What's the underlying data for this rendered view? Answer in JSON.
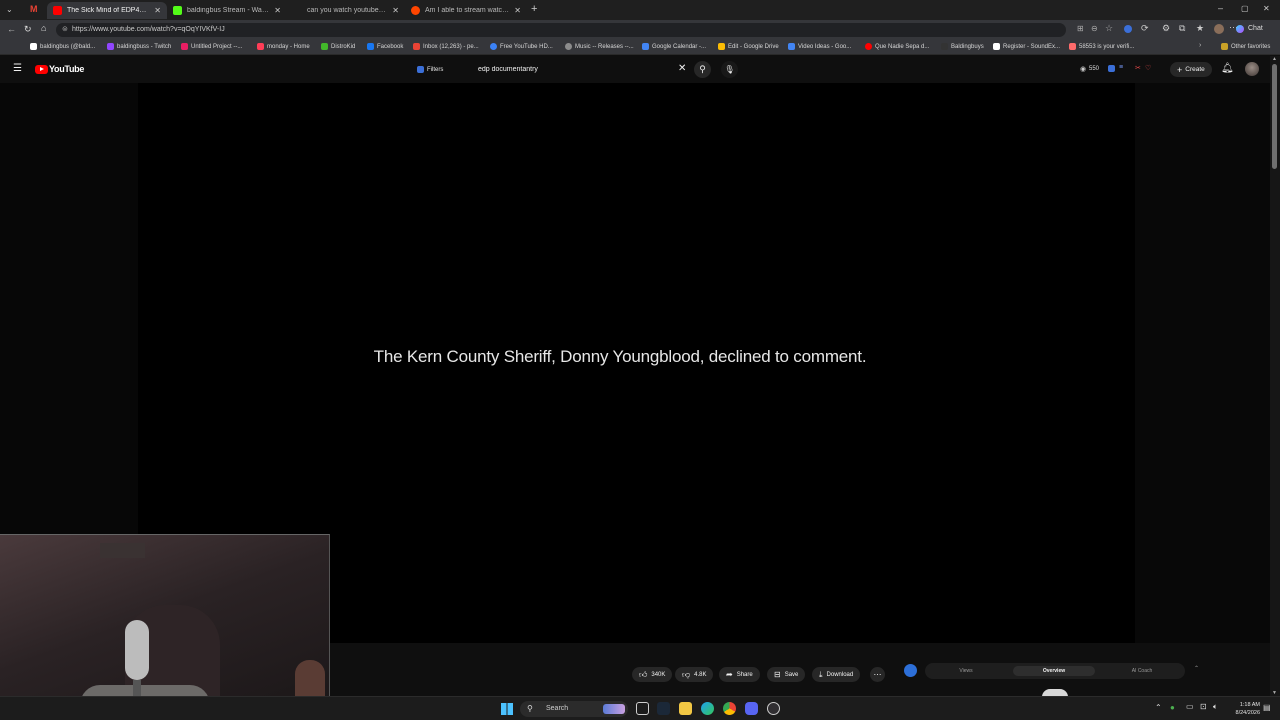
{
  "browser": {
    "tabs": [
      {
        "title": "The Sick Mind of EDP445 | Ch",
        "active": true,
        "favicon_color": "#ff0000"
      },
      {
        "title": "baldingbus Stream - Watch Live o",
        "active": false,
        "favicon_color": "#53fc18"
      },
      {
        "title": "can you watch youtube on kick",
        "active": false,
        "favicon_color": "#4285f4"
      },
      {
        "title": "Am I able to stream watching You",
        "active": false,
        "favicon_color": "#ff4500"
      }
    ],
    "url": "https://www.youtube.com/watch?v=qOqYIVKfV-IJ",
    "bookmarks": [
      {
        "label": "baldingbus (@bald...",
        "color": "#ffffff"
      },
      {
        "label": "baldingbuss - Twitch",
        "color": "#9146ff"
      },
      {
        "label": "Untitled Project --...",
        "color": "#e91e63"
      },
      {
        "label": "monday - Home",
        "color": "#ff3d57"
      },
      {
        "label": "DistroKid",
        "color": "#42b72a"
      },
      {
        "label": "Facebook",
        "color": "#1877f2"
      },
      {
        "label": "Inbox (12,263) - pe...",
        "color": "#ea4335"
      },
      {
        "label": "Free YouTube HD...",
        "color": "#3b82f6"
      },
      {
        "label": "Music -- Releases --...",
        "color": "#8c8c8c"
      },
      {
        "label": "Google Calendar -...",
        "color": "#4285f4"
      },
      {
        "label": "Edit - Google Drive",
        "color": "#fbbc04"
      },
      {
        "label": "Video Ideas - Goo...",
        "color": "#4285f4"
      },
      {
        "label": "Que Nadie Sepa d...",
        "color": "#ff0000"
      },
      {
        "label": "Baldingbuys",
        "color": "#333333"
      },
      {
        "label": "Register - SoundEx...",
        "color": "#ffffff"
      },
      {
        "label": "58553 is your verifi...",
        "color": "#ff6b6b"
      }
    ],
    "other_bookmarks": "Other favorites",
    "chat_label": "Chat"
  },
  "youtube": {
    "logo_text": "YouTube",
    "filters_label": "Filters",
    "search_value": "edp documentantry",
    "view_counter": "550",
    "create_label": "Create"
  },
  "video": {
    "caption": "The Kern County Sheriff, Donny Youngblood, declined to comment."
  },
  "actions": {
    "likes": "340K",
    "dislikes": "4.8K",
    "share": "Share",
    "save": "Save",
    "download": "Download",
    "extension_tabs": [
      "Views",
      "Overview",
      "AI Coach"
    ],
    "extension_active": "Overview"
  },
  "taskbar": {
    "search_label": "Search",
    "time": "1:18 AM",
    "date": "8/24/2026"
  },
  "colors": {
    "youtube_red": "#ff0000",
    "background": "#0f0f0f",
    "button_bg": "#272727"
  }
}
